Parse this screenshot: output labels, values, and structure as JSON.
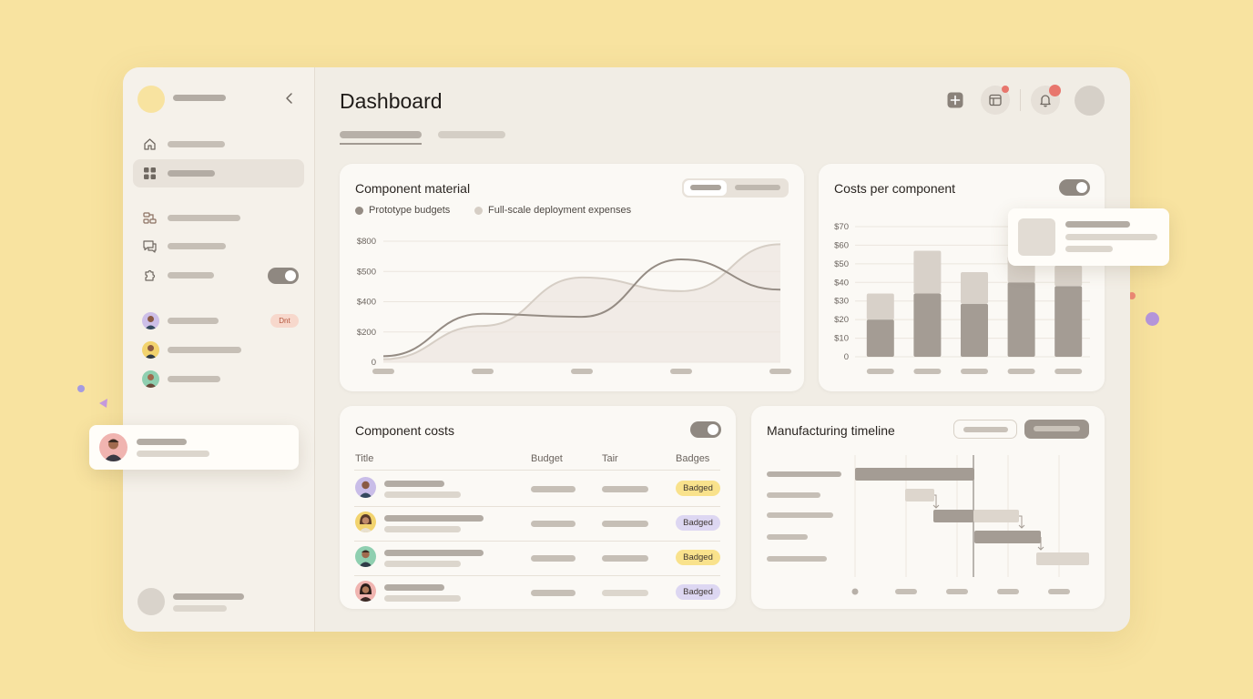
{
  "app": {
    "title": "Dashboard"
  },
  "sidebar": {
    "user_badge": "Dnt"
  },
  "cards": {
    "component_material": {
      "title": "Component material",
      "legend": [
        "Prototype budgets",
        "Full-scale deployment expenses"
      ]
    },
    "costs_per_component": {
      "title": "Costs per component"
    },
    "component_costs": {
      "title": "Component costs",
      "headers": {
        "title": "Title",
        "budget": "Budget",
        "tair": "Tair",
        "badges": "Badges"
      },
      "rows": [
        {
          "badge": "Badged",
          "badge_color": "#f9e28c"
        },
        {
          "badge": "Badged",
          "badge_color": "#ddd7f2"
        },
        {
          "badge": "Badged",
          "badge_color": "#f9e28c"
        },
        {
          "badge": "Badged",
          "badge_color": "#ddd7f2"
        }
      ]
    },
    "manufacturing_timeline": {
      "title": "Manufacturing timeline"
    }
  },
  "chart_data": [
    {
      "type": "line",
      "title": "Component material",
      "y_ticks": [
        "$800",
        "$500",
        "$400",
        "$200",
        "0"
      ],
      "ylim": [
        0,
        800
      ],
      "x": [
        0,
        1,
        2,
        3,
        4
      ],
      "series": [
        {
          "name": "Prototype budgets",
          "color": "#958c84",
          "values": [
            40,
            320,
            300,
            680,
            480
          ]
        },
        {
          "name": "Full-scale deployment expenses",
          "color": "#d6cec5",
          "values": [
            20,
            240,
            560,
            470,
            780
          ]
        }
      ],
      "grid": true
    },
    {
      "type": "bar",
      "title": "Costs per component",
      "y_ticks": [
        "$70",
        "$60",
        "$50",
        "$40",
        "$30",
        "$20",
        "$10",
        "0"
      ],
      "ylim": [
        0,
        70
      ],
      "categories": [
        "",
        "",
        "",
        "",
        ""
      ],
      "series": [
        {
          "color": "#a49c94",
          "values": [
            20,
            34,
            28.5,
            40,
            38
          ]
        },
        {
          "color": "#d8d1c9",
          "values": [
            14,
            23,
            17,
            14,
            11
          ]
        }
      ],
      "stacked": true,
      "grid": true
    }
  ],
  "colors": {
    "background": "#f8e3a0",
    "accent_red": "#e8766d",
    "toggle": "#8f8881"
  }
}
